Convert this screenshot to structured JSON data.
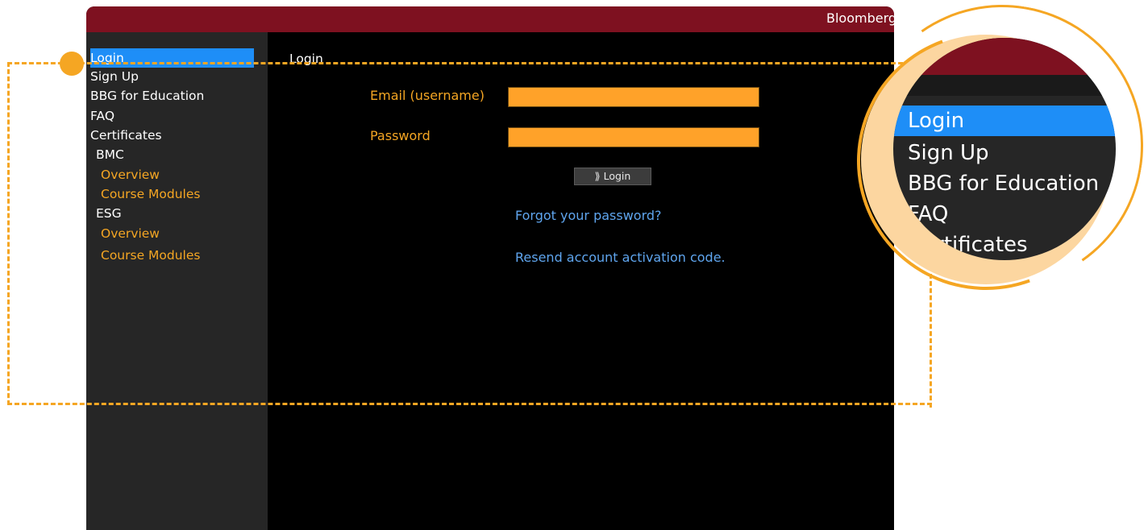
{
  "window": {
    "brand": "Bloomberg"
  },
  "sidebar": {
    "items": [
      {
        "label": "Login",
        "active": true,
        "level": 0
      },
      {
        "label": "Sign Up",
        "level": 0
      },
      {
        "label": "BBG for Education",
        "level": 0
      },
      {
        "label": "FAQ",
        "level": 0
      },
      {
        "label": "Certificates",
        "level": 0
      },
      {
        "label": "BMC",
        "level": 1
      },
      {
        "label": "Overview",
        "level": 2
      },
      {
        "label": "Course Modules",
        "level": 2
      },
      {
        "label": "ESG",
        "level": 1
      },
      {
        "label": "Overview",
        "level": 2
      },
      {
        "label": "Course Modules",
        "level": 2
      }
    ]
  },
  "main": {
    "title": "Login",
    "email_label": "Email (username)",
    "email_value": "",
    "password_label": "Password",
    "password_value": "",
    "login_button": "⟫ Login",
    "forgot_link": "Forgot your password?",
    "resend_link": "Resend account activation code."
  },
  "zoom": {
    "items": [
      "Login",
      "Sign Up",
      "BBG for Education",
      "FAQ",
      "Certificates"
    ]
  },
  "colors": {
    "titlebar": "#7e1120",
    "accent": "#f5a623",
    "highlight": "#1e8ef7",
    "link": "#5fa5ee"
  }
}
